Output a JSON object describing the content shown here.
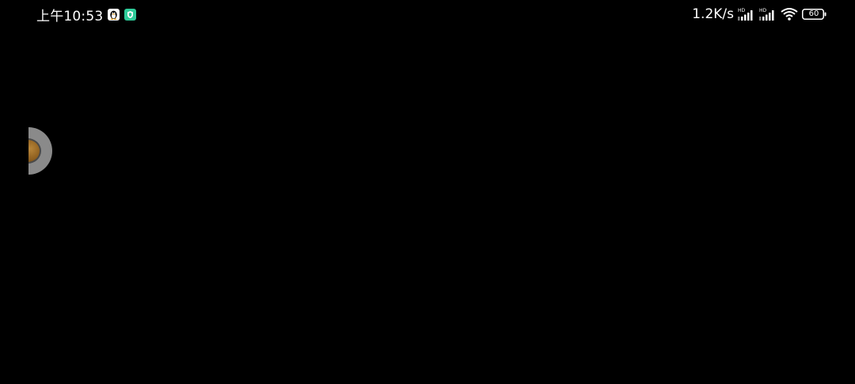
{
  "status_bar": {
    "time": "上午10:53",
    "notifications": [
      {
        "icon": "qq-penguin-icon"
      },
      {
        "icon": "security-app-icon",
        "color": "#2ecc9a"
      }
    ],
    "network_speed": "1.2K/s",
    "signal_1": {
      "label": "HD",
      "icon": "cellular-signal-icon"
    },
    "signal_2": {
      "label": "HD",
      "icon": "cellular-signal-icon"
    },
    "wifi": {
      "icon": "wifi-icon"
    },
    "battery": {
      "level": "60",
      "icon": "battery-icon"
    }
  },
  "floating_ball": {
    "icon": "floating-assistant-icon"
  },
  "colors": {
    "background": "#000000",
    "status_text": "#ffffff",
    "accent_green": "#2ecc9a",
    "ball_ring": "#8a8a8a",
    "ball_core": "#a87530"
  }
}
